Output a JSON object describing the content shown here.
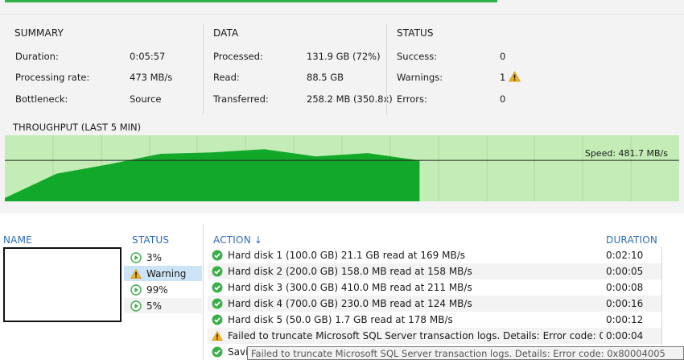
{
  "summary": {
    "title": "SUMMARY",
    "rows": [
      {
        "label": "Duration:",
        "value": "0:05:57"
      },
      {
        "label": "Processing rate:",
        "value": "473 MB/s"
      },
      {
        "label": "Bottleneck:",
        "value": "Source"
      }
    ]
  },
  "data_section": {
    "title": "DATA",
    "rows": [
      {
        "label": "Processed:",
        "value": "131.9 GB (72%)"
      },
      {
        "label": "Read:",
        "value": "88.5 GB"
      },
      {
        "label": "Transferred:",
        "value": "258.2 MB (350.8x)"
      }
    ]
  },
  "status_section": {
    "title": "STATUS",
    "rows": [
      {
        "label": "Success:",
        "value": "0"
      },
      {
        "label": "Warnings:",
        "value": "1"
      },
      {
        "label": "Errors:",
        "value": "0"
      }
    ]
  },
  "throughput": {
    "title": "THROUGHPUT (LAST 5 MIN)",
    "speed_label": "Speed: 481.7 MB/s"
  },
  "chart_data": {
    "type": "area",
    "title": "THROUGHPUT (LAST 5 MIN)",
    "values": [
      0.05,
      0.42,
      0.56,
      0.72,
      0.74,
      0.79,
      0.68,
      0.73,
      0.62
    ],
    "current_speed_level": 0.62,
    "elapsed_fraction": 0.615,
    "colors": {
      "fill": "#12a82a",
      "background": "#c3ecb6",
      "grid": "#a7dc98"
    }
  },
  "columns": {
    "name": "NAME",
    "status": "STATUS",
    "action": "ACTION",
    "sort_arrow": "↓",
    "duration": "DURATION"
  },
  "objects": [
    {
      "icon": "play",
      "status": "3%"
    },
    {
      "icon": "warning",
      "status": "Warning"
    },
    {
      "icon": "play",
      "status": "99%"
    },
    {
      "icon": "play",
      "status": "5%"
    }
  ],
  "actions": [
    {
      "icon": "check",
      "text": "Hard disk 1 (100.0 GB) 21.1 GB read at 169 MB/s",
      "duration": "0:02:10"
    },
    {
      "icon": "check",
      "text": "Hard disk 2 (200.0 GB) 158.0 MB read at 158 MB/s",
      "duration": "0:00:05"
    },
    {
      "icon": "check",
      "text": "Hard disk 3 (300.0 GB) 410.0 MB read at 211 MB/s",
      "duration": "0:00:08"
    },
    {
      "icon": "check",
      "text": "Hard disk 4 (700.0 GB) 230.0 MB read at 124 MB/s",
      "duration": "0:00:16"
    },
    {
      "icon": "check",
      "text": "Hard disk 5 (50.0 GB) 1.7 GB read at 178 MB/s",
      "duration": "0:00:12"
    },
    {
      "icon": "warning",
      "text": "Failed to truncate Microsoft SQL Server transaction logs. Details:  Error code: 0x80...",
      "duration": "0:00:04"
    },
    {
      "icon": "check",
      "text": "Savi",
      "duration": ""
    }
  ],
  "tooltip": "Failed to truncate Microsoft SQL Server transaction logs. Details:  Error code: 0x80004005",
  "colors": {
    "accent": "#2b6cb5",
    "success": "#3cae47",
    "warning": "#f2b01e",
    "selection": "#cce4f7"
  }
}
